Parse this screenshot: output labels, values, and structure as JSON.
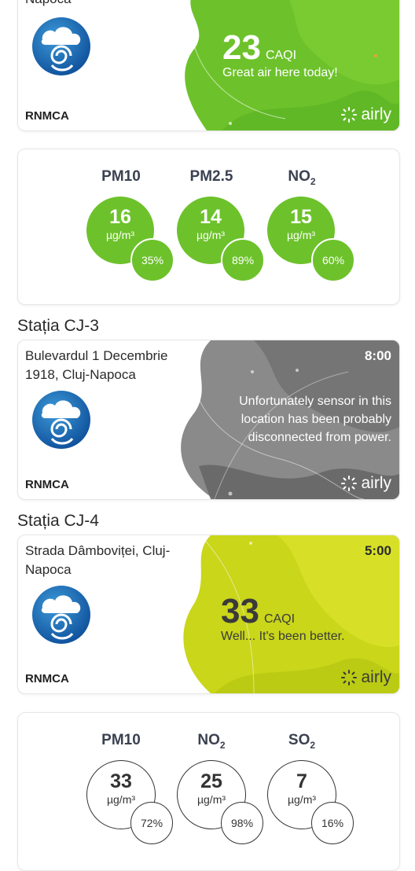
{
  "cards": {
    "top": {
      "address_tail": "Napoca",
      "provider": "RNMCA",
      "caqi": "23",
      "caqi_unit": "CAQI",
      "message": "Great air here today!",
      "brand": "airly",
      "color": "#6dc22b"
    },
    "cj3": {
      "title": "Stația CJ-3",
      "address": "Bulevardul 1 Decembrie 1918, Cluj-Napoca",
      "time": "8:00",
      "message": "Unfortunately sensor in this location has been probably disconnected from power.",
      "provider": "RNMCA",
      "brand": "airly",
      "color": "#8a8a8a"
    },
    "cj4": {
      "title": "Stația CJ-4",
      "address": "Strada Dâmboviței, Cluj-Napoca",
      "time": "5:00",
      "caqi": "33",
      "caqi_unit": "CAQI",
      "message": "Well... It's been better.",
      "provider": "RNMCA",
      "brand": "airly",
      "color": "#c9d61a"
    }
  },
  "pollutants_top": [
    {
      "name": "PM10",
      "sub": "",
      "value": "16",
      "unit": "µg/m³",
      "pct": "35",
      "pct_sign": "%"
    },
    {
      "name": "PM2.5",
      "sub": "",
      "value": "14",
      "unit": "µg/m³",
      "pct": "89",
      "pct_sign": "%"
    },
    {
      "name": "NO",
      "sub": "2",
      "value": "15",
      "unit": "µg/m³",
      "pct": "60",
      "pct_sign": "%"
    }
  ],
  "pollutants_bottom": [
    {
      "name": "PM10",
      "sub": "",
      "value": "33",
      "unit": "µg/m³",
      "pct": "72",
      "pct_sign": "%"
    },
    {
      "name": "NO",
      "sub": "2",
      "value": "25",
      "unit": "µg/m³",
      "pct": "98",
      "pct_sign": "%"
    },
    {
      "name": "SO",
      "sub": "2",
      "value": "7",
      "unit": "µg/m³",
      "pct": "16",
      "pct_sign": "%"
    }
  ]
}
